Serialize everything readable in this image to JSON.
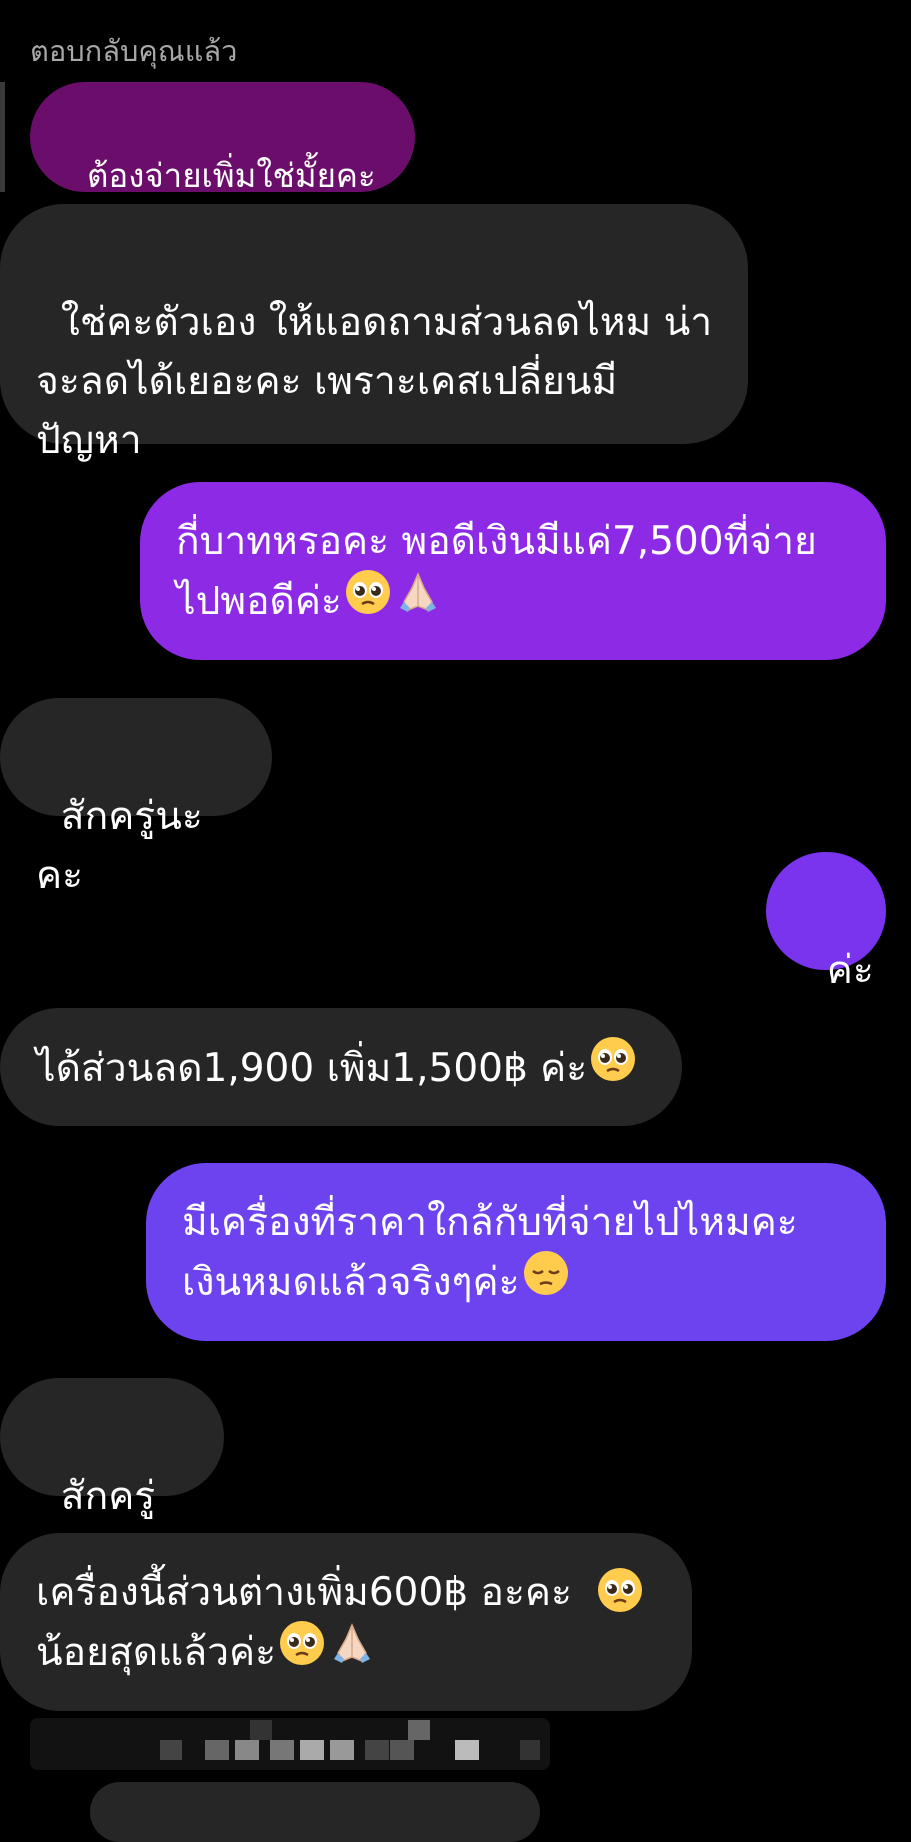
{
  "reply_header": "ตอบกลับคุณแล้ว",
  "messages": [
    {
      "text": "ต้องจ่ายเพิ่มใช่มั้ยคะ",
      "color": "#6b0d6b"
    },
    {
      "text": "ใช่คะตัวเอง ให้แอดถามส่วนลดไหม น่า\nจะลดได้เยอะคะ เพราะเคสเปลี่ยนมี\nปัญหา",
      "color": "#262626"
    },
    {
      "text": "กี่บาทหรอคะ พอดีเงินมีแค่7,500ที่จ่าย\nไปพอดีค่ะ",
      "color": "#8c2ae6",
      "emoji": [
        "pleading-face",
        "folded-hands"
      ]
    },
    {
      "text": "สักครู่นะคะ",
      "color": "#262626"
    },
    {
      "text": "ค่ะ",
      "color": "#7a34ee"
    },
    {
      "text": "ได้ส่วนลด1,900 เพิ่ม1,500฿ ค่ะ",
      "color": "#262626",
      "emoji": [
        "pleading-face"
      ]
    },
    {
      "text": "มีเครื่องที่ราคาใกล้กับที่จ่ายไปไหมคะ\nเงินหมดแล้วจริงๆค่ะ",
      "color": "#6d43f0",
      "emoji": [
        "pensive-face"
      ]
    },
    {
      "text": "สักครู่ค่ะ",
      "color": "#262626"
    },
    {
      "text": "เครื่องนี้ส่วนต่างเพิ่ม600฿ อะคะ\nน้อยสุดแล้วค่ะ",
      "color": "#262626",
      "emoji": [
        "pleading-face",
        "pleading-face",
        "folded-hands"
      ]
    }
  ]
}
